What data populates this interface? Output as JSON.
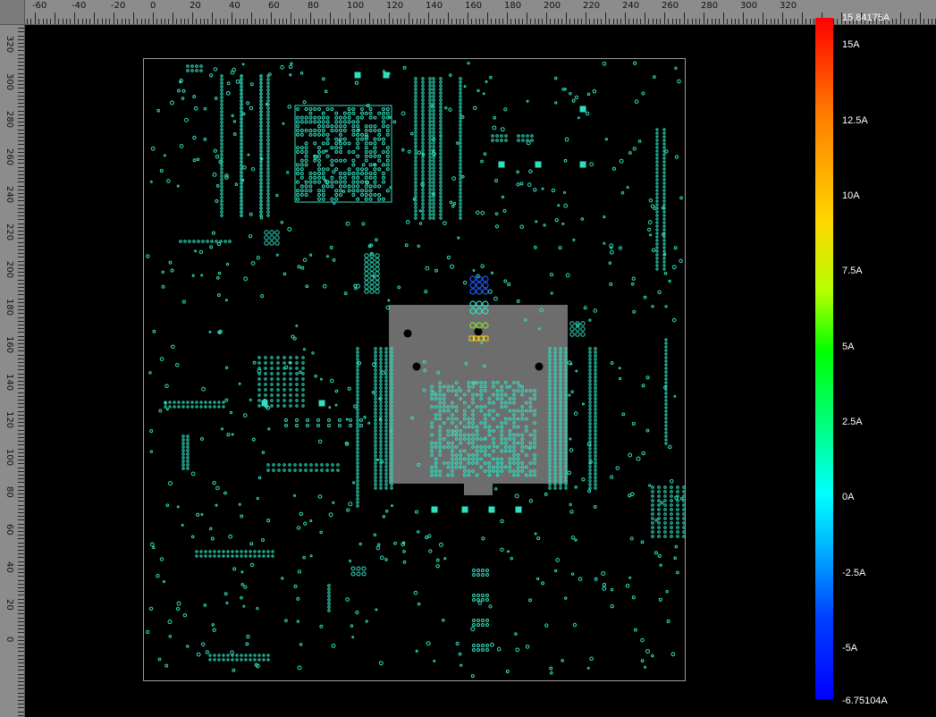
{
  "ruler": {
    "top_labels": [
      "-60",
      "-40",
      "-20",
      "0",
      "20",
      "40",
      "60",
      "80",
      "100",
      "120",
      "140",
      "160",
      "180",
      "200",
      "220",
      "240",
      "260",
      "280",
      "300",
      "320"
    ],
    "left_labels": [
      "320",
      "300",
      "280",
      "260",
      "240",
      "220",
      "200",
      "180",
      "160",
      "140",
      "120",
      "100",
      "80",
      "60",
      "40",
      "20",
      "0"
    ]
  },
  "legend": {
    "max": "15.84175A",
    "labels": [
      "15A",
      "12.5A",
      "10A",
      "7.5A",
      "5A",
      "2.5A",
      "0A",
      "-2.5A",
      "-5A"
    ],
    "min": "-6.75104A",
    "colors": {
      "high": "#ff0000",
      "mid": "#00ff00",
      "zero": "#00ffff",
      "low": "#0000ff"
    }
  },
  "board": {
    "pad_color": "#2fe0c0",
    "highlight_pad_colors": [
      "#1a5cff",
      "#2fe0c0",
      "#7fe020",
      "#f0d010"
    ]
  }
}
